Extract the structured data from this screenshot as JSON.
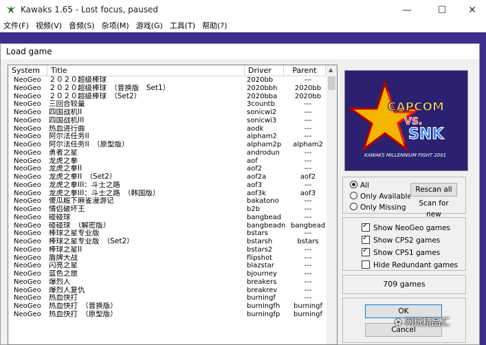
{
  "window": {
    "title": "Kawaks 1.65 - Lost focus, paused",
    "minimize": "—",
    "maximize": "☐",
    "close": "✕"
  },
  "menu": [
    "文件(F)",
    "视频(V)",
    "音频(S)",
    "杂项(M)",
    "游戏(G)",
    "工具(T)",
    "帮助(?)"
  ],
  "dialog": {
    "title": "Load game",
    "columns": [
      "System",
      "Title",
      "Driver",
      "Parent"
    ],
    "rows": [
      [
        "NeoGeo",
        "２０２０超级棒球",
        "2020bb",
        "---"
      ],
      [
        "NeoGeo",
        "２０２０超级棒球　（普换版　Set1）",
        "2020bbh",
        "2020bb"
      ],
      [
        "NeoGeo",
        "２０２０超级棒球　（Set2）",
        "2020bba",
        "2020bb"
      ],
      [
        "NeoGeo",
        "三回合较量",
        "3countb",
        "---"
      ],
      [
        "NeoGeo",
        "四国战机II",
        "sonicwi2",
        "---"
      ],
      [
        "NeoGeo",
        "四国战机III",
        "sonicwi3",
        "---"
      ],
      [
        "NeoGeo",
        "热血进行曲",
        "aodk",
        "---"
      ],
      [
        "NeoGeo",
        "阿尔法任务II",
        "alpham2",
        "---"
      ],
      [
        "NeoGeo",
        "阿尔法任务II　（原型版）",
        "alpham2p",
        "alpham2"
      ],
      [
        "NeoGeo",
        "勇者之星",
        "androdun",
        "---"
      ],
      [
        "NeoGeo",
        "龙虎之拳",
        "aof",
        "---"
      ],
      [
        "NeoGeo",
        "龙虎之拳II",
        "aof2",
        "---"
      ],
      [
        "NeoGeo",
        "龙虎之拳II　（Set2）",
        "aof2a",
        "aof2"
      ],
      [
        "NeoGeo",
        "龙虎之拳III：斗士之路",
        "aof3",
        "---"
      ],
      [
        "NeoGeo",
        "龙虎之拳III：斗士之路　（韩国版）",
        "aof3k",
        "aof3"
      ],
      [
        "NeoGeo",
        "傻瓜殿下麻雀漫游记",
        "bakatono",
        "---"
      ],
      [
        "NeoGeo",
        "情侣破坏王",
        "b2b",
        "---"
      ],
      [
        "NeoGeo",
        "碰碰球",
        "bangbead",
        "---"
      ],
      [
        "NeoGeo",
        "碰碰球　（解密版）",
        "bangbeadn",
        "bangbead"
      ],
      [
        "NeoGeo",
        "棒球之星专业版",
        "bstars",
        "---"
      ],
      [
        "NeoGeo",
        "棒球之星专业版　（Set2）",
        "bstarsh",
        "bstars"
      ],
      [
        "NeoGeo",
        "棒球之星II",
        "bstars2",
        "---"
      ],
      [
        "NeoGeo",
        "盾牌大战",
        "flipshot",
        "---"
      ],
      [
        "NeoGeo",
        "闪亮之星",
        "blazstar",
        "---"
      ],
      [
        "NeoGeo",
        "蓝色之旅",
        "bjourney",
        "---"
      ],
      [
        "NeoGeo",
        "爆烈人",
        "breakers",
        "---"
      ],
      [
        "NeoGeo",
        "爆烈人复仇",
        "breakrev",
        "---"
      ],
      [
        "NeoGeo",
        "热血快打",
        "burningf",
        "---"
      ],
      [
        "NeoGeo",
        "热血快打　（普换版）",
        "burningfh",
        "burningf"
      ],
      [
        "NeoGeo",
        "热血快打　（原型版）",
        "burningfp",
        "burningf"
      ]
    ],
    "logo": {
      "top": "CAPCOM",
      "vs": "VS.",
      "bottom": "SNK",
      "tag": "KAWAKS MILLENNIUM FIGHT 2001"
    },
    "filter": {
      "all": "All",
      "only_available": "Only Available",
      "only_missing": "Only Missing",
      "selected": "all"
    },
    "rescan_all": "Rescan all",
    "scan_for_new": "Scan for new",
    "checks": [
      {
        "label": "Show NeoGeo games",
        "checked": true
      },
      {
        "label": "Show CPS2 games",
        "checked": true
      },
      {
        "label": "Show CPS1 games",
        "checked": true
      },
      {
        "label": "Hide Redundant games",
        "checked": false
      }
    ],
    "game_count": "709 games",
    "ok": "OK",
    "cancel": "Cancel"
  },
  "watermark": "网玩精品汇",
  "colors": {
    "desktop": "#3b2e8c",
    "dialog": "#f0f0f0"
  }
}
